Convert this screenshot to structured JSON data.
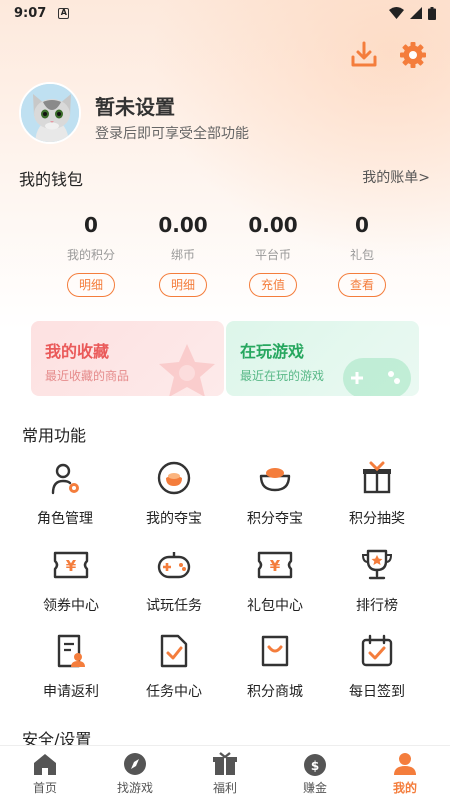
{
  "status_bar": {
    "time": "9:07",
    "app_letter": "A"
  },
  "profile": {
    "name": "暂未设置",
    "subtitle": "登录后即可享受全部功能"
  },
  "wallet": {
    "title": "我的钱包",
    "bill_link": "我的账单>",
    "items": [
      {
        "value": "0",
        "label": "我的积分",
        "button": "明细"
      },
      {
        "value": "0.00",
        "label": "绑币",
        "button": "明细"
      },
      {
        "value": "0.00",
        "label": "平台币",
        "button": "充值"
      },
      {
        "value": "0",
        "label": "礼包",
        "button": "查看"
      }
    ]
  },
  "cards": {
    "favorites": {
      "title": "我的收藏",
      "subtitle": "最近收藏的商品"
    },
    "playing": {
      "title": "在玩游戏",
      "subtitle": "最近在玩的游戏"
    }
  },
  "features": {
    "title": "常用功能",
    "items": [
      {
        "label": "角色管理",
        "icon": "role-icon"
      },
      {
        "label": "我的夺宝",
        "icon": "treasure-icon"
      },
      {
        "label": "积分夺宝",
        "icon": "points-treasure-icon"
      },
      {
        "label": "积分抽奖",
        "icon": "lottery-gift-icon"
      },
      {
        "label": "领券中心",
        "icon": "coupon-icon"
      },
      {
        "label": "试玩任务",
        "icon": "gamepad-icon"
      },
      {
        "label": "礼包中心",
        "icon": "gift-ticket-icon"
      },
      {
        "label": "排行榜",
        "icon": "trophy-icon"
      },
      {
        "label": "申请返利",
        "icon": "rebate-doc-icon"
      },
      {
        "label": "任务中心",
        "icon": "task-doc-icon"
      },
      {
        "label": "积分商城",
        "icon": "shopping-bag-icon"
      },
      {
        "label": "每日签到",
        "icon": "calendar-check-icon"
      }
    ]
  },
  "safety": {
    "title": "安全/设置"
  },
  "bottom_nav": [
    {
      "label": "首页",
      "icon": "home-icon"
    },
    {
      "label": "找游戏",
      "icon": "compass-icon"
    },
    {
      "label": "福利",
      "icon": "gift-icon"
    },
    {
      "label": "赚金",
      "icon": "money-bag-icon"
    },
    {
      "label": "我的",
      "icon": "user-icon",
      "active": true
    }
  ],
  "colors": {
    "accent": "#f47d3c",
    "icon_dark": "#333333",
    "card_red": "#ea5a5a",
    "card_green": "#27a75f"
  }
}
